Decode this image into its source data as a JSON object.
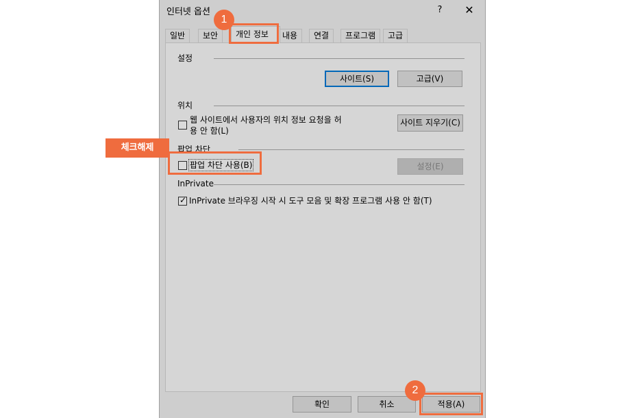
{
  "dialog": {
    "title": "인터넷 옵션",
    "help_label": "?",
    "close_label": "✕"
  },
  "tabs": [
    {
      "label": "일반"
    },
    {
      "label": "보안"
    },
    {
      "label": "개인 정보",
      "active": true
    },
    {
      "label": "내용"
    },
    {
      "label": "연결"
    },
    {
      "label": "프로그램"
    },
    {
      "label": "고급"
    }
  ],
  "settings": {
    "label": "설정",
    "sites_button": "사이트(S)",
    "advanced_button": "고급(V)"
  },
  "location": {
    "label": "위치",
    "checkbox_line1": "웹 사이트에서 사용자의 위치 정보 요청을 허",
    "checkbox_line2": "용 안 함(L)",
    "checked": false,
    "clear_sites_button": "사이트 지우기(C)"
  },
  "popup": {
    "label": "팝업 차단",
    "checkbox_label": "팝업 차단 사용(B)",
    "checked": false,
    "settings_button": "설정(E)"
  },
  "inprivate": {
    "label": "InPrivate",
    "checkbox_label": "InPrivate 브라우징 시작 시 도구 모음 및 확장 프로그램 사용 안 함(T)",
    "checked": true
  },
  "footer": {
    "ok_button": "확인",
    "cancel_button": "취소",
    "apply_button": "적용(A)"
  },
  "annotations": {
    "marker1": "1",
    "marker2": "2",
    "callout": "체크해제",
    "accent_color": "#ef6c3e"
  }
}
